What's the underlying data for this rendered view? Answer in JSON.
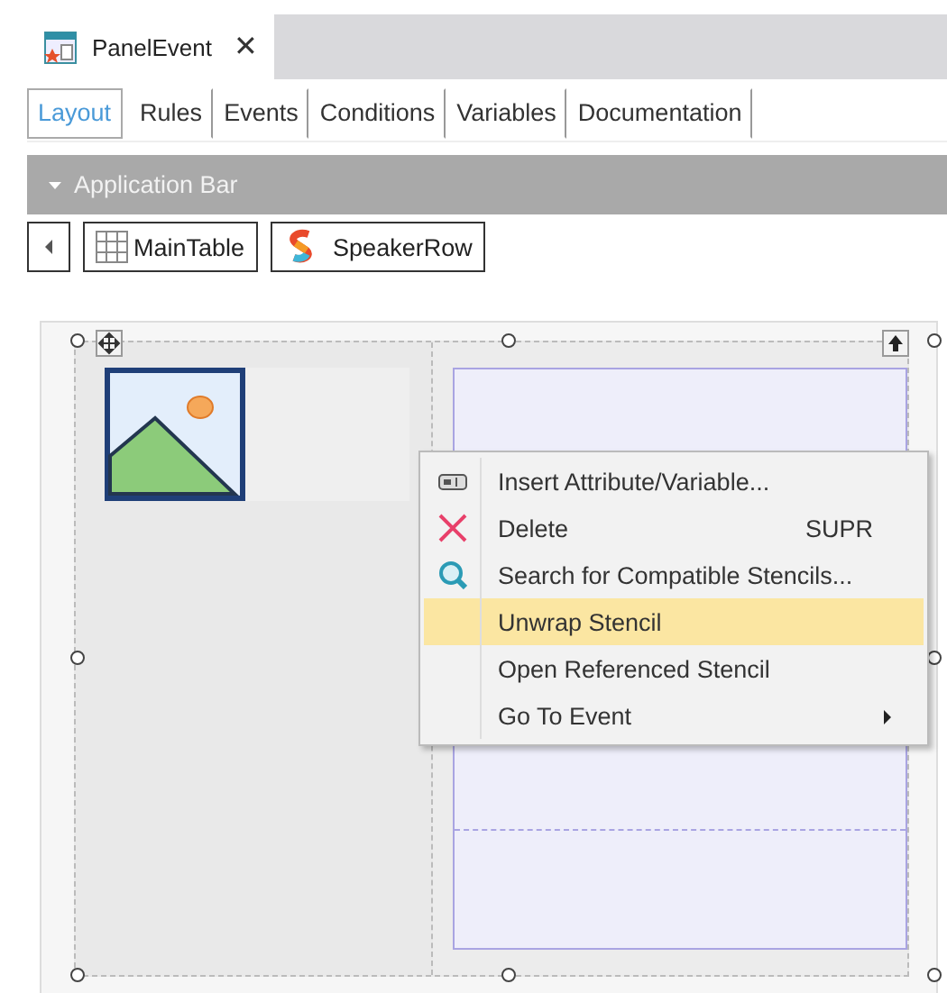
{
  "document_tab": {
    "title": "PanelEvent",
    "close": "✕"
  },
  "tabs": [
    {
      "label": "Layout",
      "selected": true
    },
    {
      "label": "Rules",
      "selected": false
    },
    {
      "label": "Events",
      "selected": false
    },
    {
      "label": "Conditions",
      "selected": false
    },
    {
      "label": "Variables",
      "selected": false
    },
    {
      "label": "Documentation",
      "selected": false
    }
  ],
  "application_bar": {
    "title": "Application Bar"
  },
  "breadcrumb": [
    {
      "label": "MainTable",
      "kind": "table"
    },
    {
      "label": "SpeakerRow",
      "kind": "stencil"
    }
  ],
  "context_menu": {
    "items": [
      {
        "label": "Insert Attribute/Variable...",
        "kind": "field",
        "selected": false,
        "submenu": false
      },
      {
        "label": "Delete",
        "shortcut": "SUPR",
        "kind": "delete",
        "selected": false,
        "submenu": false
      },
      {
        "label": "Search for Compatible Stencils...",
        "kind": "search",
        "selected": false,
        "submenu": false
      },
      {
        "label": "Unwrap Stencil",
        "kind": "none",
        "selected": true,
        "submenu": false
      },
      {
        "label": "Open Referenced Stencil",
        "kind": "none",
        "selected": false,
        "submenu": false
      },
      {
        "label": "Go To Event",
        "kind": "none",
        "selected": false,
        "submenu": true
      }
    ]
  }
}
